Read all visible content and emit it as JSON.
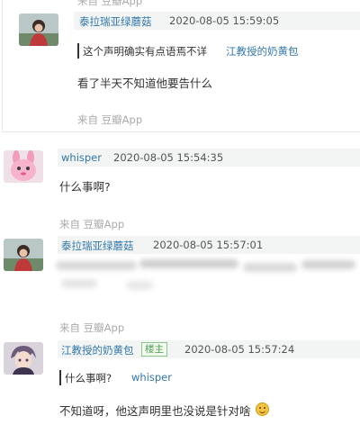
{
  "comments": [
    {
      "author": "泰拉瑞亚绿蘑菇",
      "time": "2020-08-05 15:59:05",
      "quote_text": "这个声明确实有点语焉不详",
      "quote_author": "江教授的奶黄包",
      "text": "看了半天不知道他要告什么",
      "source": "来自 豆瓣App"
    },
    {
      "author": "whisper",
      "time": "2020-08-05 15:54:35",
      "text": "什么事啊?",
      "source": "来自 豆瓣App"
    },
    {
      "author": "泰拉瑞亚绿蘑菇",
      "time": "2020-08-05 15:57:01",
      "source": "来自 豆瓣App"
    },
    {
      "author": "江教授的奶黄包",
      "badge": "楼主",
      "time": "2020-08-05 15:57:24",
      "quote_text": "什么事啊?",
      "quote_author": "whisper",
      "text": "不知道呀，他这声明里也没说是针对啥"
    }
  ],
  "top_cut_source": "来自 豆瓣App",
  "icons": {
    "avatar_1": "avatar-mushroom-girl",
    "avatar_2": "avatar-pink-bunny",
    "avatar_3": "avatar-mushroom-girl",
    "avatar_4": "avatar-anime-boy",
    "emoji": "grinning-sweat-emoji"
  },
  "colors": {
    "link": "#3377aa",
    "header_bg": "#f2f5f3",
    "badge_border": "#8ac58b",
    "source_gray": "#aaaaaa"
  }
}
